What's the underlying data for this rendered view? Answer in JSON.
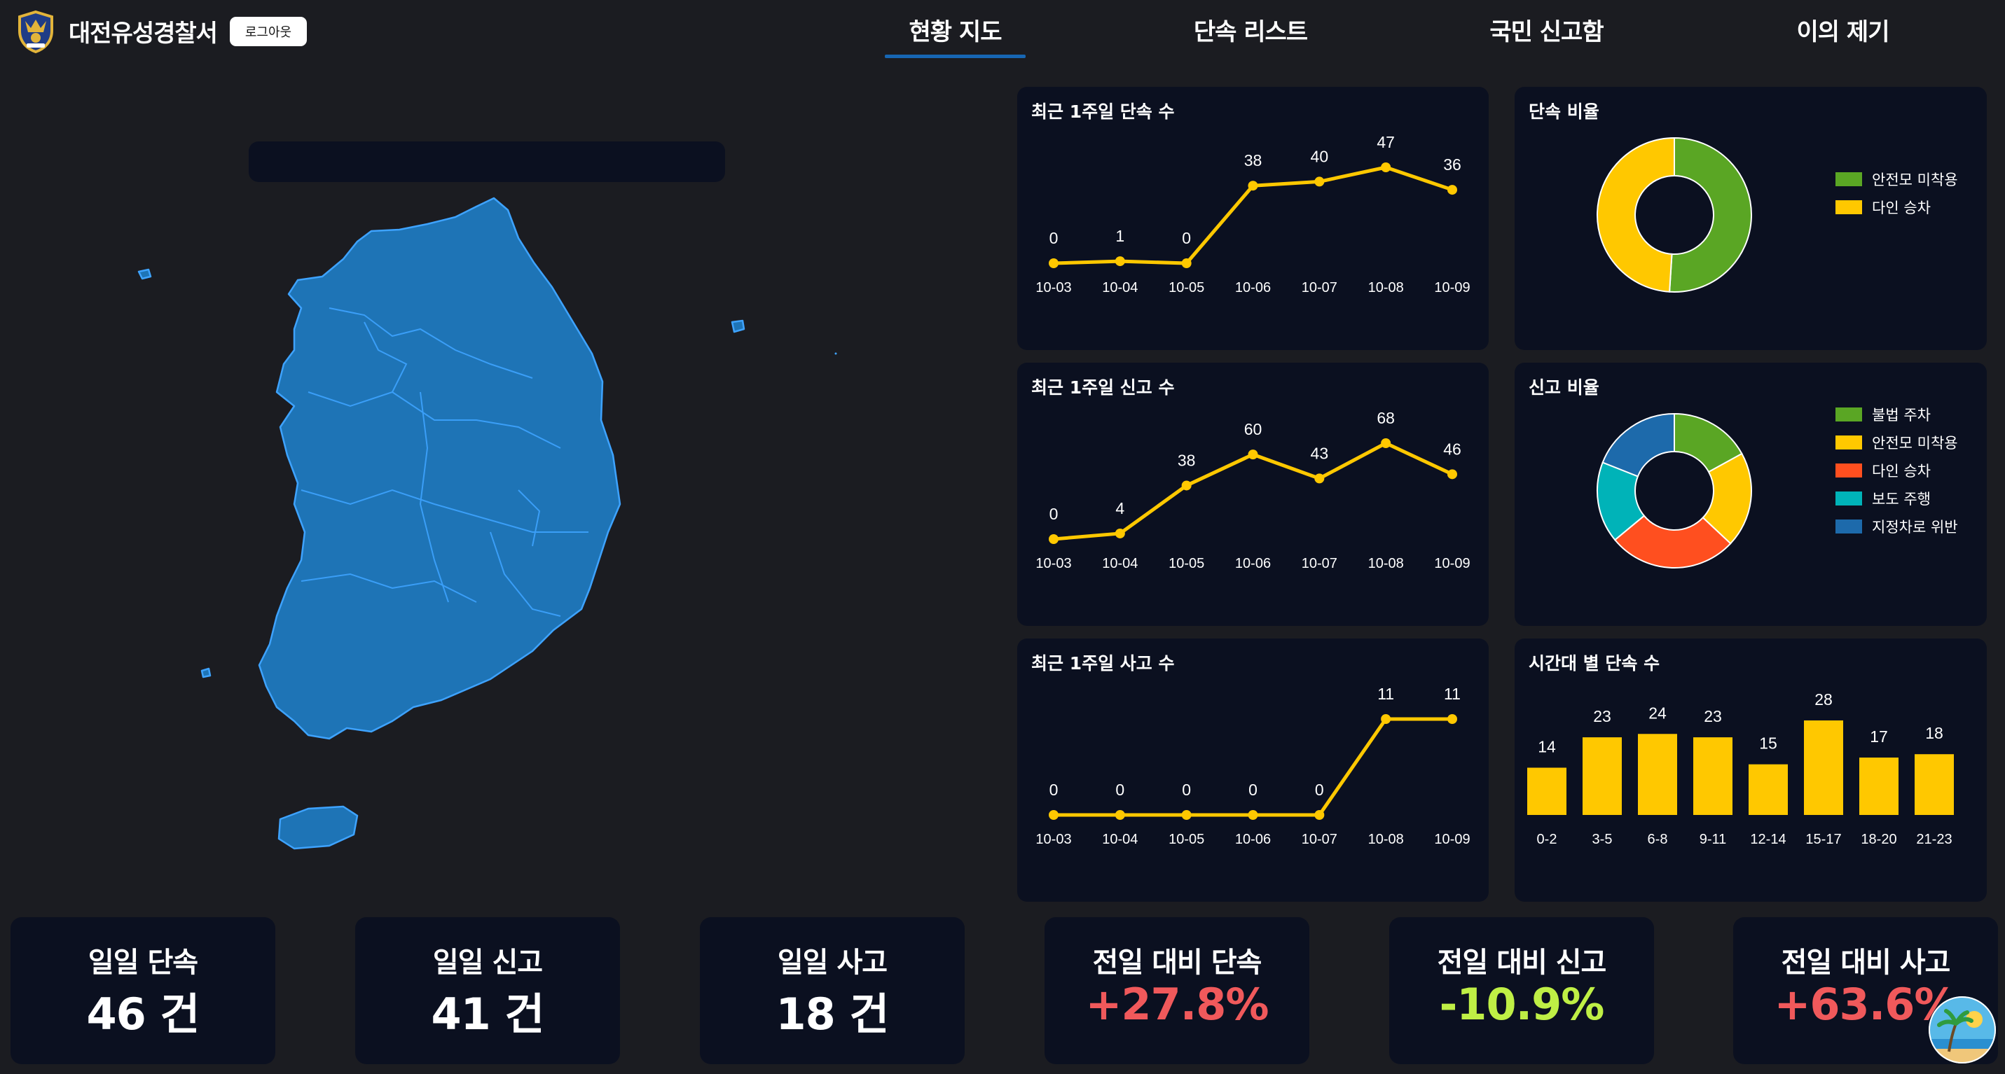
{
  "header": {
    "station_name": "대전유성경찰서",
    "logout_label": "로그아웃",
    "tabs": [
      {
        "label": "현황 지도"
      },
      {
        "label": "단속 리스트"
      },
      {
        "label": "국민 신고함"
      },
      {
        "label": "이의 제기"
      }
    ],
    "active_tab": "현황 지도"
  },
  "map": {
    "region": "South Korea",
    "fill": "#1e74b6",
    "stroke": "#3ea3ff"
  },
  "cards": {
    "enforcement_trend": {
      "title": "최근 1주일 단속 수",
      "chart_data": {
        "type": "line",
        "x": [
          "10-03",
          "10-04",
          "10-05",
          "10-06",
          "10-07",
          "10-08",
          "10-09"
        ],
        "values": [
          0,
          1,
          0,
          38,
          40,
          47,
          36
        ]
      }
    },
    "report_trend": {
      "title": "최근 1주일 신고 수",
      "chart_data": {
        "type": "line",
        "x": [
          "10-03",
          "10-04",
          "10-05",
          "10-06",
          "10-07",
          "10-08",
          "10-09"
        ],
        "values": [
          0,
          4,
          38,
          60,
          43,
          68,
          46
        ]
      }
    },
    "accident_trend": {
      "title": "최근 1주일 사고 수",
      "chart_data": {
        "type": "line",
        "x": [
          "10-03",
          "10-04",
          "10-05",
          "10-06",
          "10-07",
          "10-08",
          "10-09"
        ],
        "values": [
          0,
          0,
          0,
          0,
          0,
          11,
          11
        ]
      }
    },
    "enforcement_ratio": {
      "title": "단속 비율",
      "chart_data": {
        "type": "pie",
        "labels": [
          "안전모 미착용",
          "다인 승차"
        ],
        "values": [
          51,
          49
        ],
        "colors": [
          "#5aa624",
          "#ffc800"
        ]
      }
    },
    "report_ratio": {
      "title": "신고 비율",
      "chart_data": {
        "type": "pie",
        "labels": [
          "불법 주차",
          "안전모 미착용",
          "다인 승차",
          "보도 주행",
          "지정차로 위반"
        ],
        "values": [
          17,
          20,
          27,
          17,
          19
        ],
        "colors": [
          "#5aa624",
          "#ffc800",
          "#ff4f1f",
          "#00b3b8",
          "#1d6aab"
        ]
      }
    },
    "hourly": {
      "title": "시간대 별 단속 수",
      "chart_data": {
        "type": "bar",
        "categories": [
          "0-2",
          "3-5",
          "6-8",
          "9-11",
          "12-14",
          "15-17",
          "18-20",
          "21-23"
        ],
        "values": [
          14,
          23,
          24,
          23,
          15,
          28,
          17,
          18
        ]
      }
    }
  },
  "stats": [
    {
      "label": "일일 단속",
      "value": "46 건",
      "color": "#ffffff"
    },
    {
      "label": "일일 신고",
      "value": "41 건",
      "color": "#ffffff"
    },
    {
      "label": "일일 사고",
      "value": "18 건",
      "color": "#ffffff"
    },
    {
      "label": "전일 대비 단속",
      "value": "+27.8%",
      "color": "#f0595b"
    },
    {
      "label": "전일 대비 신고",
      "value": "-10.9%",
      "color": "#bfef45"
    },
    {
      "label": "전일 대비 사고",
      "value": "+63.6%",
      "color": "#f0595b"
    }
  ],
  "colors": {
    "background": "#1b1c21",
    "card": "#0b1020",
    "line": "#ffc800",
    "accent": "#1766b3"
  }
}
